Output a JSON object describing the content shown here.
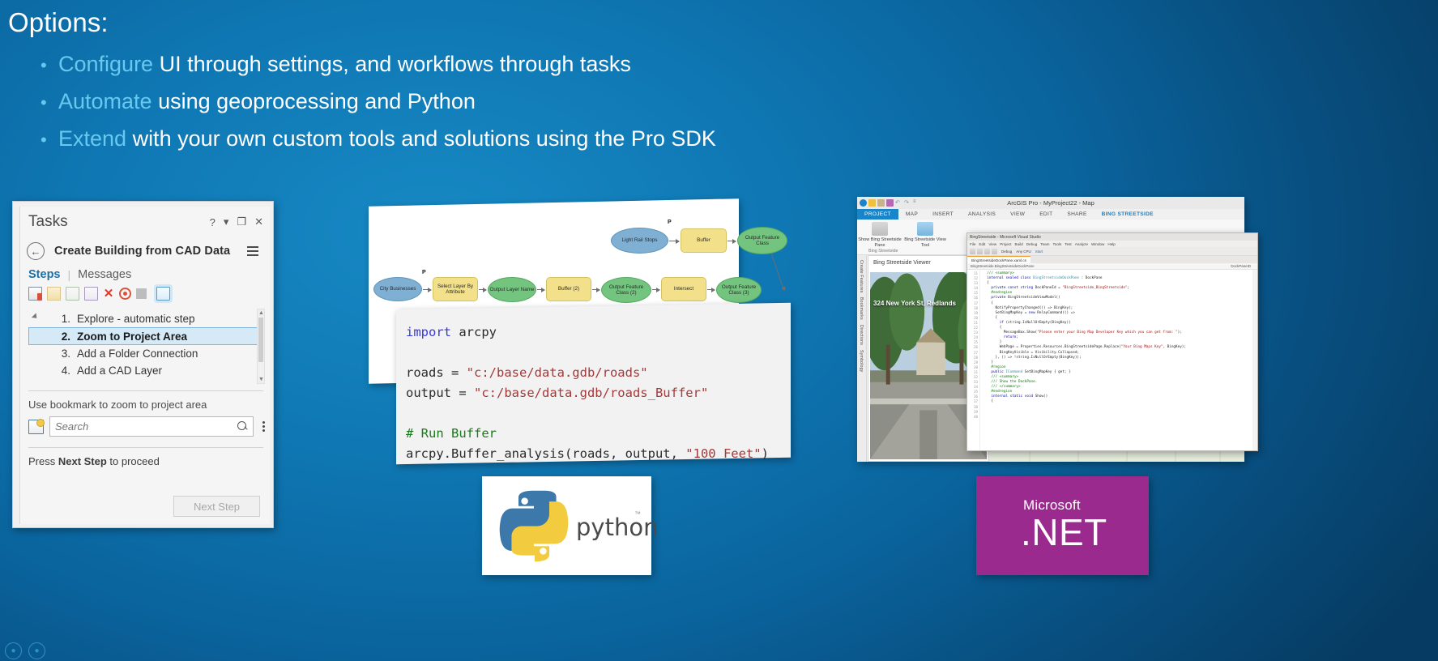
{
  "slide": {
    "title": "Options:",
    "bullets": [
      {
        "keyword": "Configure",
        "rest": " UI through settings, and workflows through tasks"
      },
      {
        "keyword": "Automate",
        "rest": " using geoprocessing and Python"
      },
      {
        "keyword": "Extend",
        "rest": " with your own custom tools and solutions using the Pro SDK"
      }
    ],
    "accent_color": "#69c8ee",
    "background_color": "#0f78b4"
  },
  "tasks_pane": {
    "title": "Tasks",
    "help_button": "?",
    "dropdown_button": "▾",
    "maximize_button": "❐",
    "close_button": "✕",
    "back_button": "←",
    "task_name": "Create Building from CAD Data",
    "menu_button": "menu",
    "tabs": {
      "steps": "Steps",
      "separator": "|",
      "messages": "Messages"
    },
    "toolbar_icons": [
      "new-step-icon",
      "open-folder-icon",
      "validate-icon",
      "properties-icon",
      "delete-icon",
      "record-icon",
      "stop-icon",
      "edit-step-icon"
    ],
    "steps": [
      {
        "number": "1.",
        "label": "Explore - automatic step",
        "selected": false
      },
      {
        "number": "2.",
        "label": "Zoom to Project Area",
        "selected": true
      },
      {
        "number": "3.",
        "label": "Add a Folder Connection",
        "selected": false
      },
      {
        "number": "4.",
        "label": "Add a CAD Layer",
        "selected": false
      }
    ],
    "instruction": "Use bookmark to zoom to project area",
    "search_placeholder": "Search",
    "search_value": "",
    "proceed_prefix": "Press ",
    "proceed_bold": "Next Step",
    "proceed_suffix": " to proceed",
    "next_step_button": "Next Step"
  },
  "model_builder": {
    "nodes": [
      {
        "id": "light-rail-stops",
        "label": "Light Rail Stops",
        "type": "variable-input",
        "param": "P"
      },
      {
        "id": "buffer",
        "label": "Buffer",
        "type": "tool"
      },
      {
        "id": "output-feature-class",
        "label": "Output Feature Class",
        "type": "variable-output"
      },
      {
        "id": "city-businesses",
        "label": "City Businesses",
        "type": "variable-input",
        "param": "P"
      },
      {
        "id": "select-layer-by-attribute",
        "label": "Select Layer By Attribute",
        "type": "tool"
      },
      {
        "id": "output-layer-name",
        "label": "Output Layer Name",
        "type": "variable-output"
      },
      {
        "id": "buffer-2",
        "label": "Buffer (2)",
        "type": "tool"
      },
      {
        "id": "output-feature-class-2",
        "label": "Output Feature Class (2)",
        "type": "variable-output"
      },
      {
        "id": "intersect",
        "label": "Intersect",
        "type": "tool"
      },
      {
        "id": "output-feature-class-3",
        "label": "Output Feature Class (3)",
        "type": "variable-output"
      }
    ],
    "colors": {
      "variable_input": "#7fb0d3",
      "tool": "#f2e18a",
      "variable_output": "#73c47e"
    }
  },
  "code_card": {
    "language": "python",
    "lines": [
      {
        "tokens": [
          {
            "t": "import",
            "c": "kw"
          },
          {
            "t": " arcpy",
            "c": "pl"
          }
        ]
      },
      {
        "tokens": []
      },
      {
        "tokens": [
          {
            "t": "roads = ",
            "c": "pl"
          },
          {
            "t": "\"c:/base/data.gdb/roads\"",
            "c": "str"
          }
        ]
      },
      {
        "tokens": [
          {
            "t": "output = ",
            "c": "pl"
          },
          {
            "t": "\"c:/base/data.gdb/roads_Buffer\"",
            "c": "str"
          }
        ]
      },
      {
        "tokens": []
      },
      {
        "tokens": [
          {
            "t": "# Run Buffer",
            "c": "cmt"
          }
        ]
      },
      {
        "tokens": [
          {
            "t": "arcpy.Buffer_analysis(roads, output, ",
            "c": "pl"
          },
          {
            "t": "\"100 Feet\"",
            "c": "str"
          },
          {
            "t": ")",
            "c": "pl"
          }
        ]
      }
    ]
  },
  "python_logo_card": {
    "wordmark": "python",
    "trademark": "™",
    "colors": {
      "blue": "#3c78a9",
      "yellow": "#f2cb3e"
    }
  },
  "arcgis_pro": {
    "window_title": "ArcGIS Pro - MyProject22 - Map",
    "quick_access_icons": [
      "app-icon",
      "save-icon",
      "open-icon",
      "save-as-icon",
      "undo-icon",
      "redo-icon",
      "customize-icon"
    ],
    "ribbon_tabs": [
      {
        "label": "PROJECT",
        "active": true
      },
      {
        "label": "MAP",
        "active": false
      },
      {
        "label": "INSERT",
        "active": false
      },
      {
        "label": "ANALYSIS",
        "active": false
      },
      {
        "label": "VIEW",
        "active": false
      },
      {
        "label": "EDIT",
        "active": false
      },
      {
        "label": "SHARE",
        "active": false
      },
      {
        "label": "BING STREETSIDE",
        "active": false,
        "contextual": true
      }
    ],
    "ribbon_groups": [
      {
        "label": "Show Bing Streetside Pane",
        "icon": "streetside-pane-icon"
      },
      {
        "label": "Bing Streetside View Tool",
        "icon": "streetside-tool-icon"
      }
    ],
    "group_caption": "Bing Streetside",
    "side_tabs": [
      "Create Features",
      "Bookmarks",
      "Directions",
      "Symbology"
    ],
    "streetside_pane_title": "Bing Streetside Viewer",
    "street_address": "324 New York St, Redlands"
  },
  "visual_studio": {
    "window_title": "BingStreetside - Microsoft Visual Studio",
    "menu_items": [
      "File",
      "Edit",
      "View",
      "Project",
      "Build",
      "Debug",
      "Team",
      "Tools",
      "Test",
      "Analyze",
      "Window",
      "Help"
    ],
    "config": "Debug",
    "platform": "Any CPU",
    "run_button": "Start",
    "document_tab": "BingStreetsideDockPane.xaml.cs",
    "nav_left": "BingStreetside.BingStreetsideDockPane",
    "nav_right": "DockPaneID",
    "line_numbers": [
      "11",
      "12",
      "13",
      "14",
      "15",
      "16",
      "17",
      "18",
      "19",
      "20",
      "21",
      "22",
      "23",
      "24",
      "25",
      "26",
      "27",
      "28",
      "29",
      "30",
      "31",
      "32",
      "33",
      "34",
      "35",
      "36",
      "37",
      "38",
      "39",
      "40"
    ],
    "code_lines": [
      [
        {
          "t": "  ",
          "c": "pl"
        },
        {
          "t": "/// <summary>",
          "c": "cmt"
        }
      ],
      [
        {
          "t": "  ",
          "c": "pl"
        },
        {
          "t": "internal sealed class ",
          "c": "kw"
        },
        {
          "t": "BingStreetsideDockPane",
          "c": "typ"
        },
        {
          "t": " : DockPane",
          "c": "pl"
        }
      ],
      [
        {
          "t": "  {",
          "c": "pl"
        }
      ],
      [
        {
          "t": "    ",
          "c": "pl"
        },
        {
          "t": "private const string ",
          "c": "kw"
        },
        {
          "t": "DockPaneId = ",
          "c": "pl"
        },
        {
          "t": "\"BingStreetside_BingStreetside\"",
          "c": "str"
        },
        {
          "t": ";",
          "c": "pl"
        }
      ],
      [
        {
          "t": "",
          "c": "pl"
        }
      ],
      [
        {
          "t": "    ",
          "c": "pl"
        },
        {
          "t": "#endregion",
          "c": "cmt"
        }
      ],
      [
        {
          "t": "    ",
          "c": "pl"
        },
        {
          "t": "private ",
          "c": "kw"
        },
        {
          "t": "BingStreetsideViewModel()",
          "c": "pl"
        }
      ],
      [
        {
          "t": "    {",
          "c": "pl"
        }
      ],
      [
        {
          "t": "      NotifyPropertyChanged(() => BingKey);",
          "c": "pl"
        }
      ],
      [
        {
          "t": "      SetBingMapKey = ",
          "c": "pl"
        },
        {
          "t": "new ",
          "c": "kw"
        },
        {
          "t": "RelayCommand(() =>",
          "c": "pl"
        }
      ],
      [
        {
          "t": "      {",
          "c": "pl"
        }
      ],
      [
        {
          "t": "        ",
          "c": "pl"
        },
        {
          "t": "if ",
          "c": "kw"
        },
        {
          "t": "(string.IsNullOrEmpty(BingKey))",
          "c": "pl"
        }
      ],
      [
        {
          "t": "        {",
          "c": "pl"
        }
      ],
      [
        {
          "t": "          MessageBox.Show(",
          "c": "pl"
        },
        {
          "t": "\"Please enter your Bing Map Developer Key which you can get from: \"",
          "c": "str"
        },
        {
          "t": ");",
          "c": "pl"
        }
      ],
      [
        {
          "t": "          ",
          "c": "pl"
        },
        {
          "t": "return",
          "c": "kw"
        },
        {
          "t": ";",
          "c": "pl"
        }
      ],
      [
        {
          "t": "        }",
          "c": "pl"
        }
      ],
      [
        {
          "t": "        WebPage = Properties.Resources.BingStreetsidePage.Replace(",
          "c": "pl"
        },
        {
          "t": "\"Your Bing Maps Key\"",
          "c": "str"
        },
        {
          "t": ", BingKey);",
          "c": "pl"
        }
      ],
      [
        {
          "t": "        BingKeyVisible = Visibility.Collapsed;",
          "c": "pl"
        }
      ],
      [
        {
          "t": "      }, () => !string.IsNullOrEmpty(BingKey));",
          "c": "pl"
        }
      ],
      [
        {
          "t": "    }",
          "c": "pl"
        }
      ],
      [
        {
          "t": "",
          "c": "pl"
        }
      ],
      [
        {
          "t": "    ",
          "c": "pl"
        },
        {
          "t": "#region",
          "c": "cmt"
        }
      ],
      [
        {
          "t": "    ",
          "c": "pl"
        },
        {
          "t": "public ",
          "c": "kw"
        },
        {
          "t": "ICommand ",
          "c": "typ"
        },
        {
          "t": "SetBingMapKey { get; }",
          "c": "pl"
        }
      ],
      [
        {
          "t": "",
          "c": "pl"
        }
      ],
      [
        {
          "t": "    ",
          "c": "pl"
        },
        {
          "t": "/// <summary>",
          "c": "cmt"
        }
      ],
      [
        {
          "t": "    ",
          "c": "pl"
        },
        {
          "t": "/// Show the DockPane.",
          "c": "cmt"
        }
      ],
      [
        {
          "t": "    ",
          "c": "pl"
        },
        {
          "t": "/// </summary>",
          "c": "cmt"
        }
      ],
      [
        {
          "t": "    ",
          "c": "pl"
        },
        {
          "t": "#endregion",
          "c": "cmt"
        }
      ],
      [
        {
          "t": "    ",
          "c": "pl"
        },
        {
          "t": "internal static void ",
          "c": "kw"
        },
        {
          "t": "Show()",
          "c": "pl"
        }
      ],
      [
        {
          "t": "    {",
          "c": "pl"
        }
      ]
    ]
  },
  "dotnet_card": {
    "microsoft": "Microsoft",
    "dotnet": ".NET",
    "background_color": "#9b2a8e"
  },
  "bottom_dots": [
    "●",
    "●"
  ]
}
